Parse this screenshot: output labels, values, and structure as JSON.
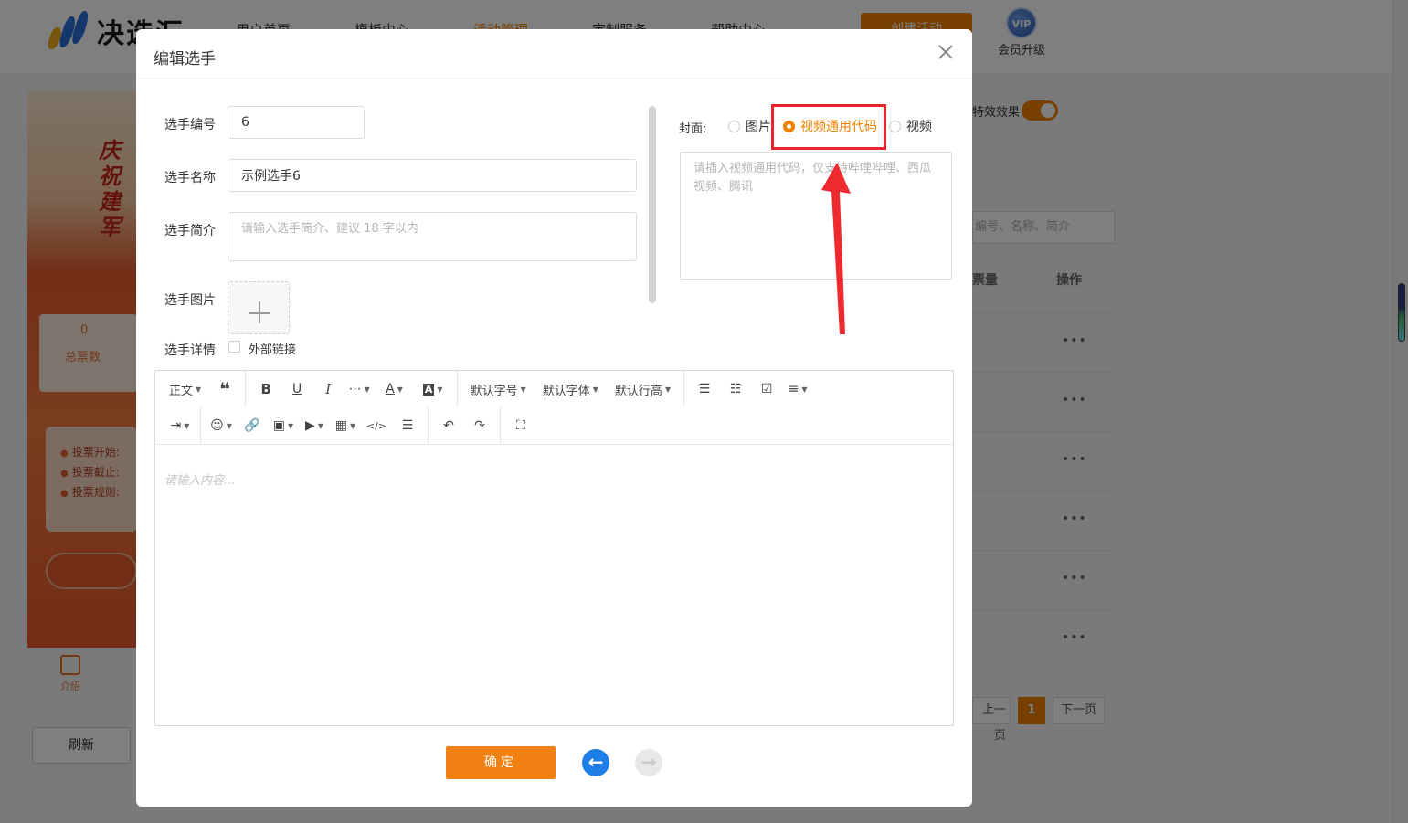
{
  "background": {
    "logo_text": "决选汇",
    "nav": [
      "用户首页",
      "模板中心",
      "活动管理",
      "定制服务",
      "帮助中心"
    ],
    "nav_active_index": 2,
    "create_button": "创建活动",
    "vip_badge": "VIP",
    "vip_label": "会员升级",
    "phone_title": "庆祝建军",
    "total_votes_value": "0",
    "total_votes_label": "总票数",
    "vote_info": [
      "投票开始:",
      "投票截止:",
      "投票规则:"
    ],
    "intro_tab": "介绍",
    "refresh_button": "刷新",
    "effect_label": "特效效果",
    "search_placeholder": "编号、名称、简介",
    "table_headers": [
      "票量",
      "操作"
    ],
    "row_action": "•••",
    "pager": {
      "prev": "上一页",
      "current": "1",
      "next": "下一页"
    },
    "accent_color": "#f08000"
  },
  "modal": {
    "title": "编辑选手",
    "fields": {
      "number_label": "选手编号",
      "number_value": "6",
      "name_label": "选手名称",
      "name_value": "示例选手6",
      "intro_label": "选手简介",
      "intro_placeholder": "请输入选手简介、建议 18 字以内",
      "image_label": "选手图片",
      "detail_label": "选手详情",
      "external_link_label": "外部链接"
    },
    "cover": {
      "label": "封面:",
      "options": [
        "图片",
        "视频通用代码",
        "视频"
      ],
      "selected": "视频通用代码",
      "code_placeholder": "请插入视频通用代码，仅支持哔哩哔哩、西瓜视频、腾讯"
    },
    "toolbar": {
      "paragraph": "正文",
      "font_size": "默认字号",
      "font_family": "默认字体",
      "line_height": "默认行高"
    },
    "editor_placeholder": "请输入内容...",
    "confirm_button": "确定",
    "highlight_color": "#e8242c"
  }
}
